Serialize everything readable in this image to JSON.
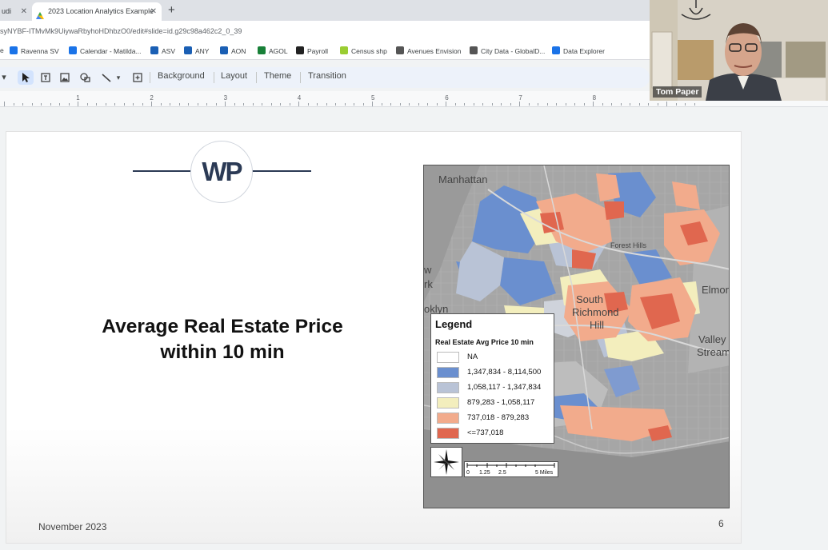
{
  "browser": {
    "tabs": [
      {
        "title": "udi",
        "active": false
      },
      {
        "title": "2023 Location Analytics Example",
        "active": true
      }
    ],
    "url": "syNYBF-ITMvMk9UiywaRbyhoHDhbzO0/edit#slide=id.g29c98a462c2_0_39",
    "bookmarks": [
      {
        "label": "Ravenna SV",
        "icon": "drive-icon",
        "color": "#1a73e8"
      },
      {
        "label": "Calendar - Matilda...",
        "icon": "drive-icon",
        "color": "#1a73e8"
      },
      {
        "label": "ASV",
        "icon": "v-icon",
        "color": "#1a5fb4"
      },
      {
        "label": "ANY",
        "icon": "v-icon",
        "color": "#1a5fb4"
      },
      {
        "label": "AON",
        "icon": "v-icon",
        "color": "#1a5fb4"
      },
      {
        "label": "AGOL",
        "icon": "plus-icon",
        "color": "#188038"
      },
      {
        "label": "Payroll",
        "icon": "payroll-icon",
        "color": "#222222"
      },
      {
        "label": "Census shp",
        "icon": "cb-icon",
        "color": "#9acd32"
      },
      {
        "label": "Avenues Envision",
        "icon": "triangle-icon",
        "color": "#555555"
      },
      {
        "label": "City Data - GlobalD...",
        "icon": "globe-icon",
        "color": "#555555"
      },
      {
        "label": "Data Explorer",
        "icon": "drive-icon",
        "color": "#1a73e8"
      }
    ]
  },
  "toolbar": {
    "background": "Background",
    "layout": "Layout",
    "theme": "Theme",
    "transition": "Transition"
  },
  "ruler": {
    "marks": [
      "1",
      "2",
      "3",
      "4",
      "5",
      "6",
      "7",
      "8"
    ]
  },
  "slide": {
    "logo": "WP",
    "title_line1": "Average Real Estate Price",
    "title_line2": "within 10 min",
    "date": "November 2023",
    "number": "6"
  },
  "map": {
    "places": {
      "manhattan": "Manhattan",
      "richmond1": "South",
      "richmond2": "Richmond",
      "richmond3": "Hill",
      "forest": "Forest Hills",
      "elmont": "Elmon",
      "valley1": "Valley",
      "valley2": "Stream",
      "brooklyn": "oklyn",
      "york": "w",
      "york2": "rk"
    },
    "legend": {
      "title": "Legend",
      "subtitle": "Real Estate Avg Price 10 min",
      "classes": [
        {
          "label": "NA",
          "color": "#ffffff"
        },
        {
          "label": "1,347,834 - 8,114,500",
          "color": "#6a8fcf"
        },
        {
          "label": "1,058,117 - 1,347,834",
          "color": "#b9c3d6"
        },
        {
          "label": "879,283 - 1,058,117",
          "color": "#f3eebd"
        },
        {
          "label": "737,018 - 879,283",
          "color": "#f2ab8c"
        },
        {
          "label": "<=737,018",
          "color": "#e0674f"
        }
      ]
    },
    "scale": [
      "0",
      "1.25",
      "2.5",
      "5 Miles"
    ]
  },
  "webcam": {
    "name": "Tom Paper"
  }
}
